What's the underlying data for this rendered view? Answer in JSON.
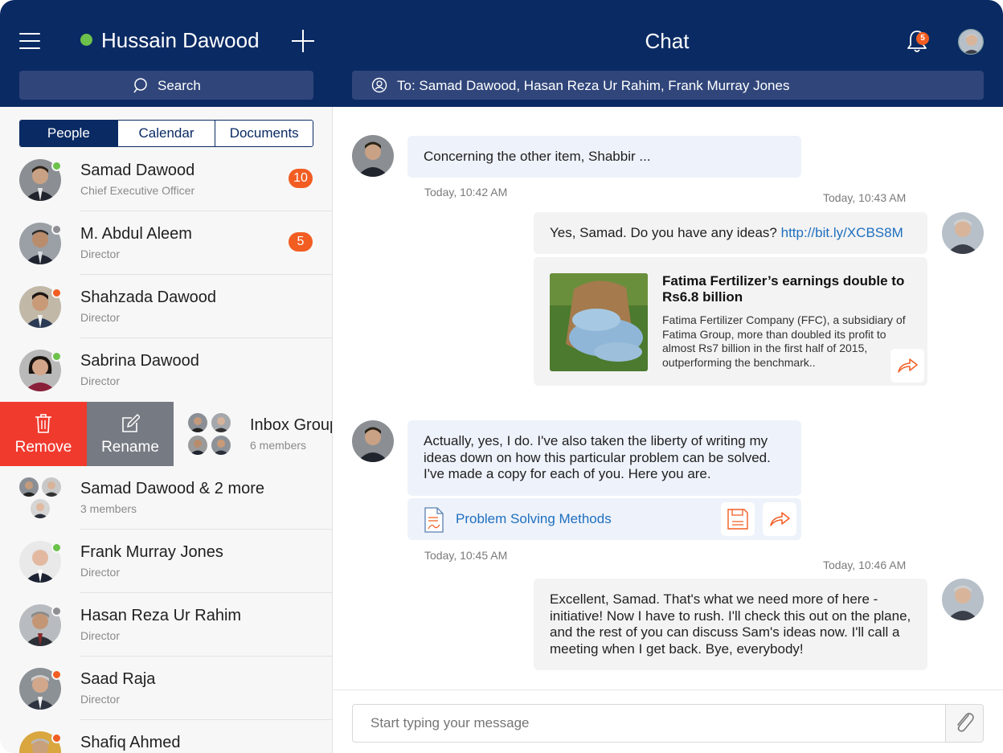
{
  "header": {
    "user_name": "Hussain Dawood",
    "title": "Chat",
    "notification_count": "5",
    "search_label": "Search",
    "recipients": "To: Samad Dawood, Hasan Reza Ur Rahim, Frank Murray Jones"
  },
  "tabs": [
    "People",
    "Calendar",
    "Documents"
  ],
  "contacts": [
    {
      "name": "Samad Dawood",
      "role": "Chief Executive Officer",
      "badge": "10",
      "presence": "online"
    },
    {
      "name": "M. Abdul Aleem",
      "role": "Director",
      "badge": "5",
      "presence": "offline"
    },
    {
      "name": "Shahzada Dawood",
      "role": "Director",
      "presence": "busy"
    },
    {
      "name": "Sabrina Dawood",
      "role": "Director",
      "presence": "online"
    }
  ],
  "swipe_row": {
    "remove_label": "Remove",
    "rename_label": "Rename",
    "name": "Inbox Group",
    "members": "6 members"
  },
  "contacts_after": [
    {
      "name": "Samad Dawood & 2 more",
      "role": "3 members",
      "group": true
    },
    {
      "name": "Frank Murray Jones",
      "role": "Director",
      "presence": "online"
    },
    {
      "name": "Hasan Reza Ur Rahim",
      "role": "Director",
      "presence": "offline"
    },
    {
      "name": "Saad Raja",
      "role": "Director",
      "presence": "busy"
    },
    {
      "name": "Shafiq Ahmed",
      "role": "",
      "presence": "busy"
    }
  ],
  "messages": {
    "m1": {
      "text": "Concerning the other item, Shabbir ...",
      "time": "Today, 10:42 AM"
    },
    "m2": {
      "text": "Yes, Samad. Do you have any ideas? ",
      "link": "http://bit.ly/XCBS8M",
      "time": "Today, 10:43 AM"
    },
    "card": {
      "title": "Fatima Fertilizer’s earnings double to Rs6.8 billion",
      "body": "Fatima Fertilizer Company (FFC), a subsidiary of Fatima Group, more than doubled its profit to almost Rs7 billion in the first half of 2015, outperforming the benchmark.."
    },
    "m3": {
      "text": "Actually, yes, I do. I've also taken the liberty of writing my ideas down on how this particular problem can be solved. I've made a copy for each of you. Here you are.",
      "time": "Today, 10:45 AM"
    },
    "attachment": "Problem Solving Methods",
    "m4": {
      "text": "Excellent, Samad. That's what we need more of here - initiative! Now I have to rush. I'll check this out on the plane, and the rest of you can discuss Sam's ideas now. I'll call a meeting when I get back. Bye, everybody!",
      "time": "Today, 10:46 AM"
    }
  },
  "composer": {
    "placeholder": "Start typing your message"
  },
  "colors": {
    "navy": "#0a2a63",
    "accent": "#f25d22",
    "online": "#6cc24a",
    "offline": "#8e8e93",
    "link": "#1f6fbf"
  },
  "icons": [
    "menu-icon",
    "plus-icon",
    "bell-icon",
    "search-icon",
    "contact-icon",
    "trash-icon",
    "edit-icon",
    "pdf-file-icon",
    "save-icon",
    "share-icon",
    "paperclip-icon"
  ]
}
